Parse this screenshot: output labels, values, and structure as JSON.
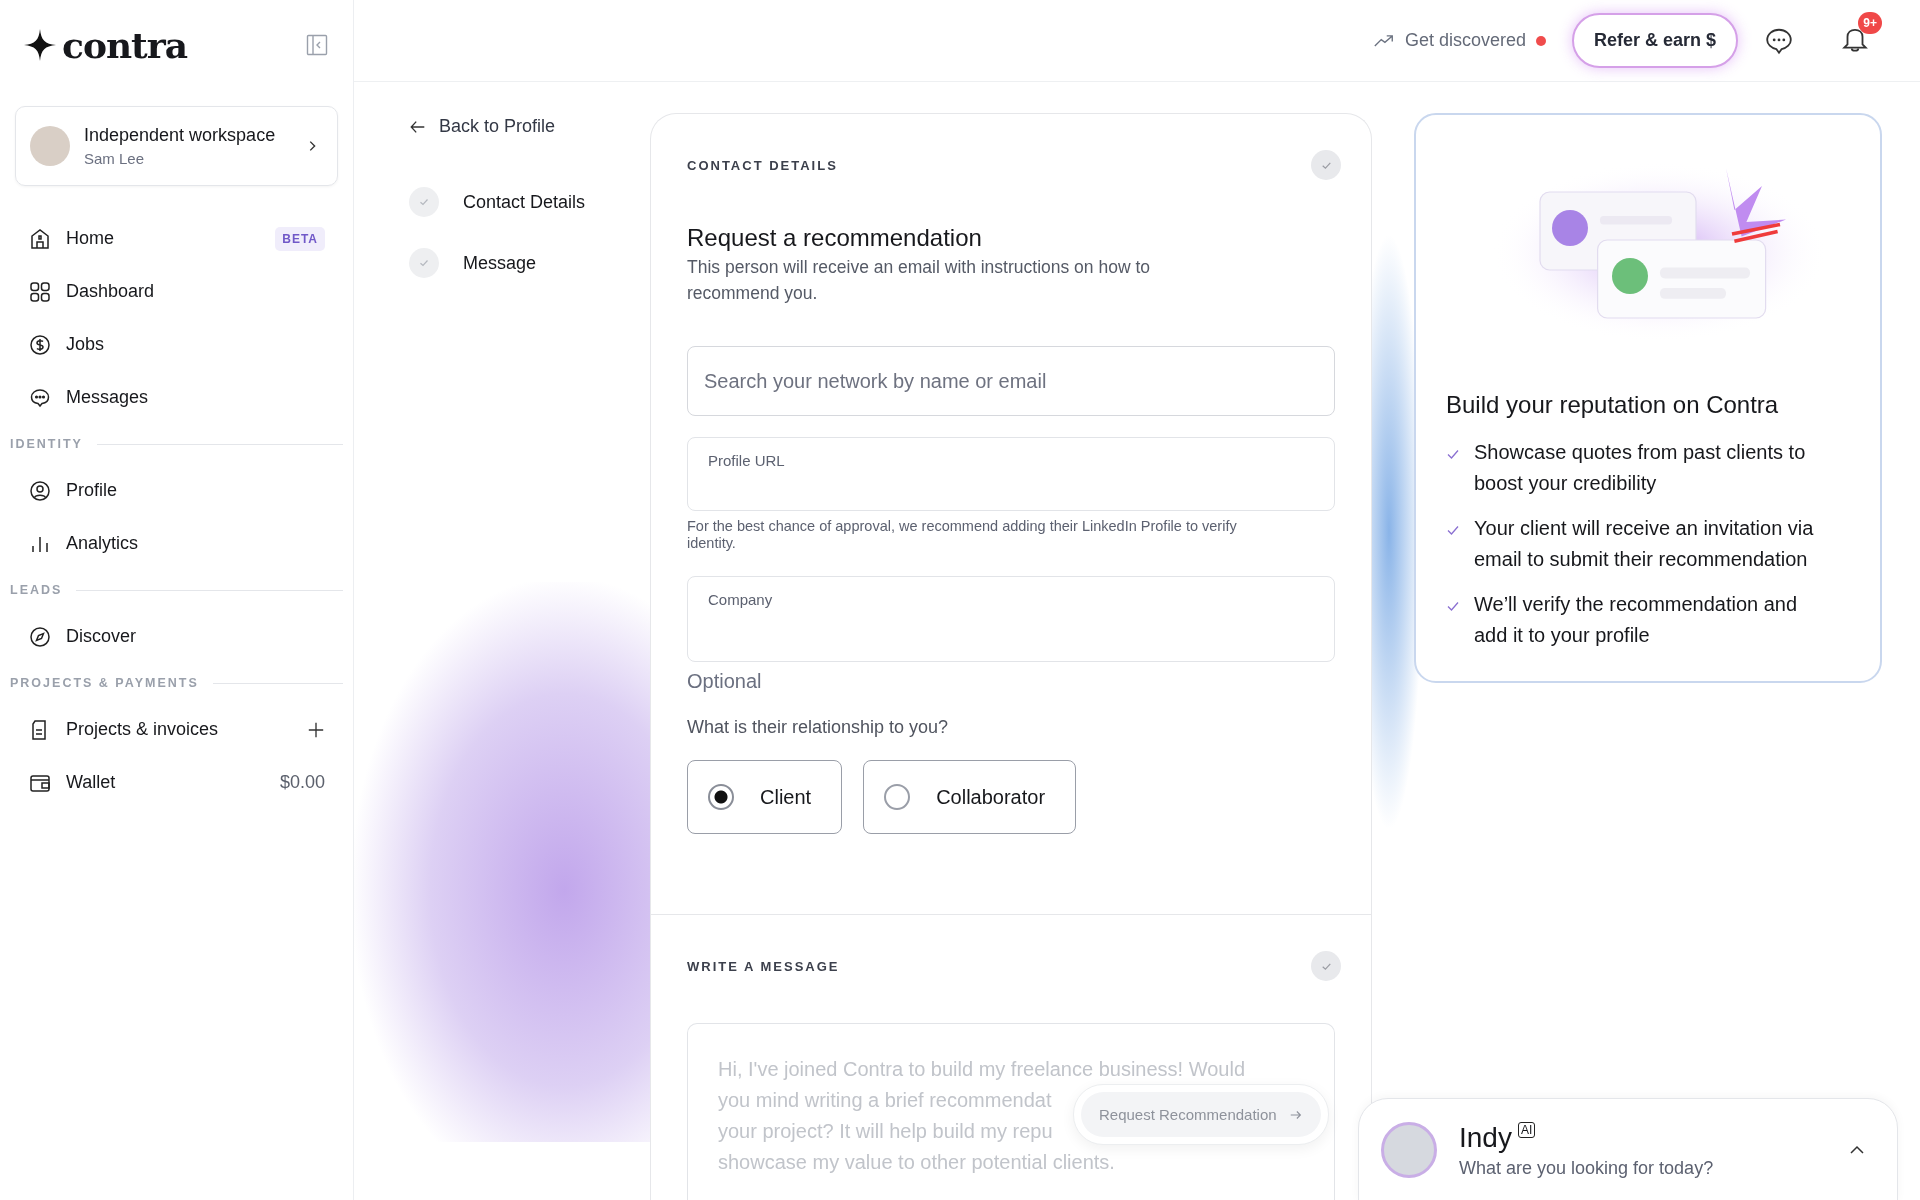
{
  "logo": {
    "text": "contra"
  },
  "workspace": {
    "title": "Independent workspace",
    "name": "Sam Lee"
  },
  "nav_sections": [
    {
      "items": [
        {
          "label": "Home",
          "badge": "BETA"
        },
        {
          "label": "Dashboard"
        },
        {
          "label": "Jobs"
        },
        {
          "label": "Messages"
        }
      ]
    },
    {
      "heading": "IDENTITY",
      "items": [
        {
          "label": "Profile"
        },
        {
          "label": "Analytics"
        }
      ]
    },
    {
      "heading": "LEADS",
      "items": [
        {
          "label": "Discover"
        }
      ]
    },
    {
      "heading": "PROJECTS & PAYMENTS",
      "items": [
        {
          "label": "Projects & invoices"
        },
        {
          "label": "Wallet",
          "value": "$0.00"
        }
      ]
    }
  ],
  "header": {
    "discover_label": "Get discovered",
    "discover_alert": true,
    "refer_button": "Refer & earn $",
    "notification_count": "9+"
  },
  "steps": {
    "back": "Back to Profile",
    "items": [
      {
        "label": "Contact Details",
        "completed": false
      },
      {
        "label": "Message",
        "completed": false
      }
    ]
  },
  "form": {
    "section_title": "CONTACT DETAILS",
    "section_completed": false,
    "title": "Request a recommendation",
    "description": "This person will receive an email with instructions on how to recommend you.",
    "search_placeholder": "Search your network by name or email",
    "profile_url_label": "Profile URL",
    "profile_url_hint": "For the best chance of approval, we recommend adding their LinkedIn Profile to verify identity.",
    "company_label": "Company",
    "company_hint": "Optional",
    "relationship_question": "What is their relationship to you?",
    "relationship_options": [
      {
        "label": "Client",
        "selected": true
      },
      {
        "label": "Collaborator",
        "selected": false
      }
    ]
  },
  "message": {
    "section_title": "WRITE A MESSAGE",
    "section_completed": false,
    "lines": [
      "Hi, I've joined Contra to build my freelance business! Would",
      "you mind writing a brief recommendat",
      "your project? It will help build my repu",
      "showcase my value to other potential clients."
    ],
    "submit_button": "Request Recommendation",
    "submit_disabled": true
  },
  "info_card": {
    "title": "Build your reputation on Contra",
    "points": [
      "Showcase quotes from past clients to boost your credibility",
      "Your client will receive an invitation via email to submit their recommendation",
      "We’ll verify the recommendation and add it to your profile"
    ]
  },
  "assistant": {
    "name": "Indy",
    "badge": "AI",
    "prompt": "What are you looking for today?",
    "expanded": false
  }
}
